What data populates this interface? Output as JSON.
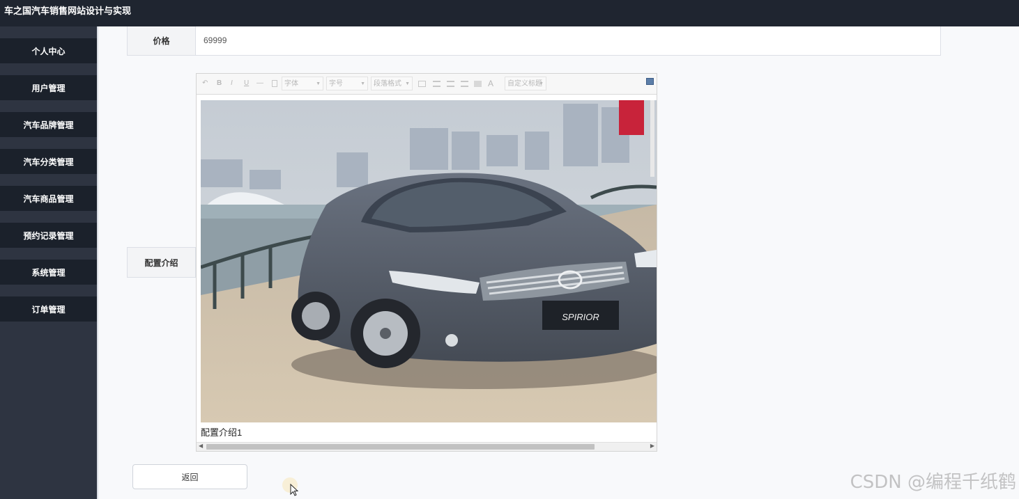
{
  "app": {
    "title": "车之国汽车销售网站设计与实现"
  },
  "sidebar": {
    "items": [
      {
        "label": "个人中心"
      },
      {
        "label": "用户管理"
      },
      {
        "label": "汽车品牌管理"
      },
      {
        "label": "汽车分类管理"
      },
      {
        "label": "汽车商品管理"
      },
      {
        "label": "预约记录管理"
      },
      {
        "label": "系统管理"
      },
      {
        "label": "订单管理"
      }
    ]
  },
  "form": {
    "price_label": "价格",
    "price_value": "69999",
    "config_label": "配置介绍",
    "editor": {
      "toolbar": {
        "undo": "↶",
        "bold": "B",
        "italic": "I",
        "underline": "U",
        "hr": "—",
        "font_family": "字体",
        "font_size": "字号",
        "paragraph": "段落格式",
        "font_color": "A",
        "custom_title": "自定义标题"
      },
      "content_caption": "配置介绍1",
      "plate_text": "SPIRIOR"
    },
    "back_button": "返回"
  },
  "watermark": "CSDN @编程千纸鹤",
  "colors": {
    "topbar": "#1f2530",
    "sidebar": "#2e3441",
    "nav_item": "#1b212b",
    "page_bg": "#f8f9fb"
  }
}
